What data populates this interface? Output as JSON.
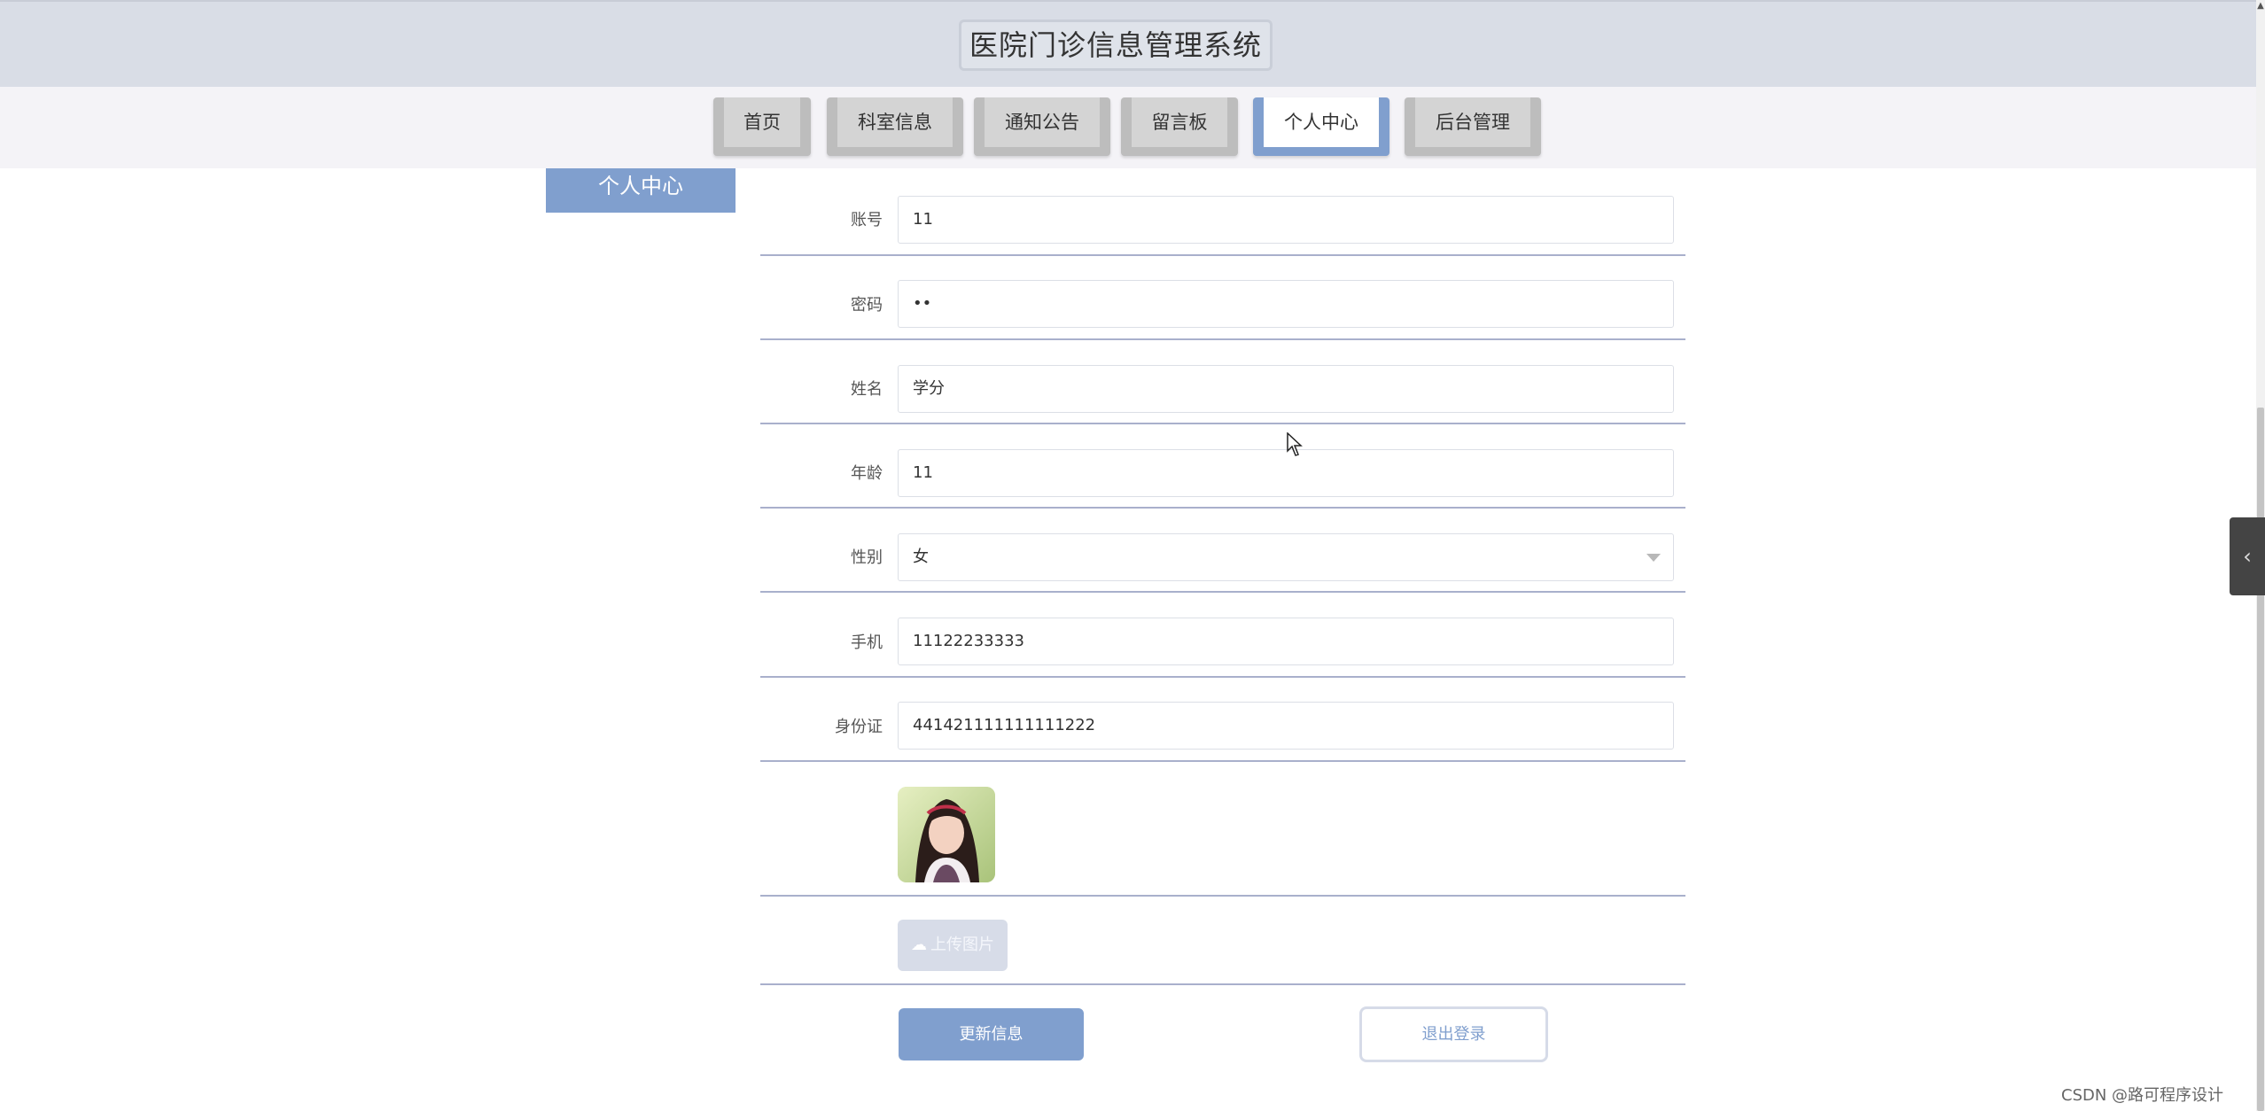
{
  "header": {
    "title": "医院门诊信息管理系统"
  },
  "nav": {
    "items": [
      {
        "label": "首页"
      },
      {
        "label": "科室信息"
      },
      {
        "label": "通知公告"
      },
      {
        "label": "留言板"
      },
      {
        "label": "个人中心"
      },
      {
        "label": "后台管理"
      }
    ],
    "active": "个人中心"
  },
  "sidebar": {
    "label": "个人中心"
  },
  "form": {
    "account": {
      "label": "账号",
      "value": "11"
    },
    "password": {
      "label": "密码",
      "value": "••"
    },
    "name": {
      "label": "姓名",
      "value": "学分"
    },
    "age": {
      "label": "年龄",
      "value": "11"
    },
    "gender": {
      "label": "性别",
      "value": "女"
    },
    "phone": {
      "label": "手机",
      "value": "11122233333"
    },
    "id_card": {
      "label": "身份证",
      "value": "441421111111111222"
    }
  },
  "upload": {
    "label": "上传图片"
  },
  "actions": {
    "update": "更新信息",
    "logout": "退出登录"
  },
  "watermark": "CSDN @路可程序设计",
  "colors": {
    "accent": "#809fce",
    "header_bg": "#d9dde6"
  }
}
